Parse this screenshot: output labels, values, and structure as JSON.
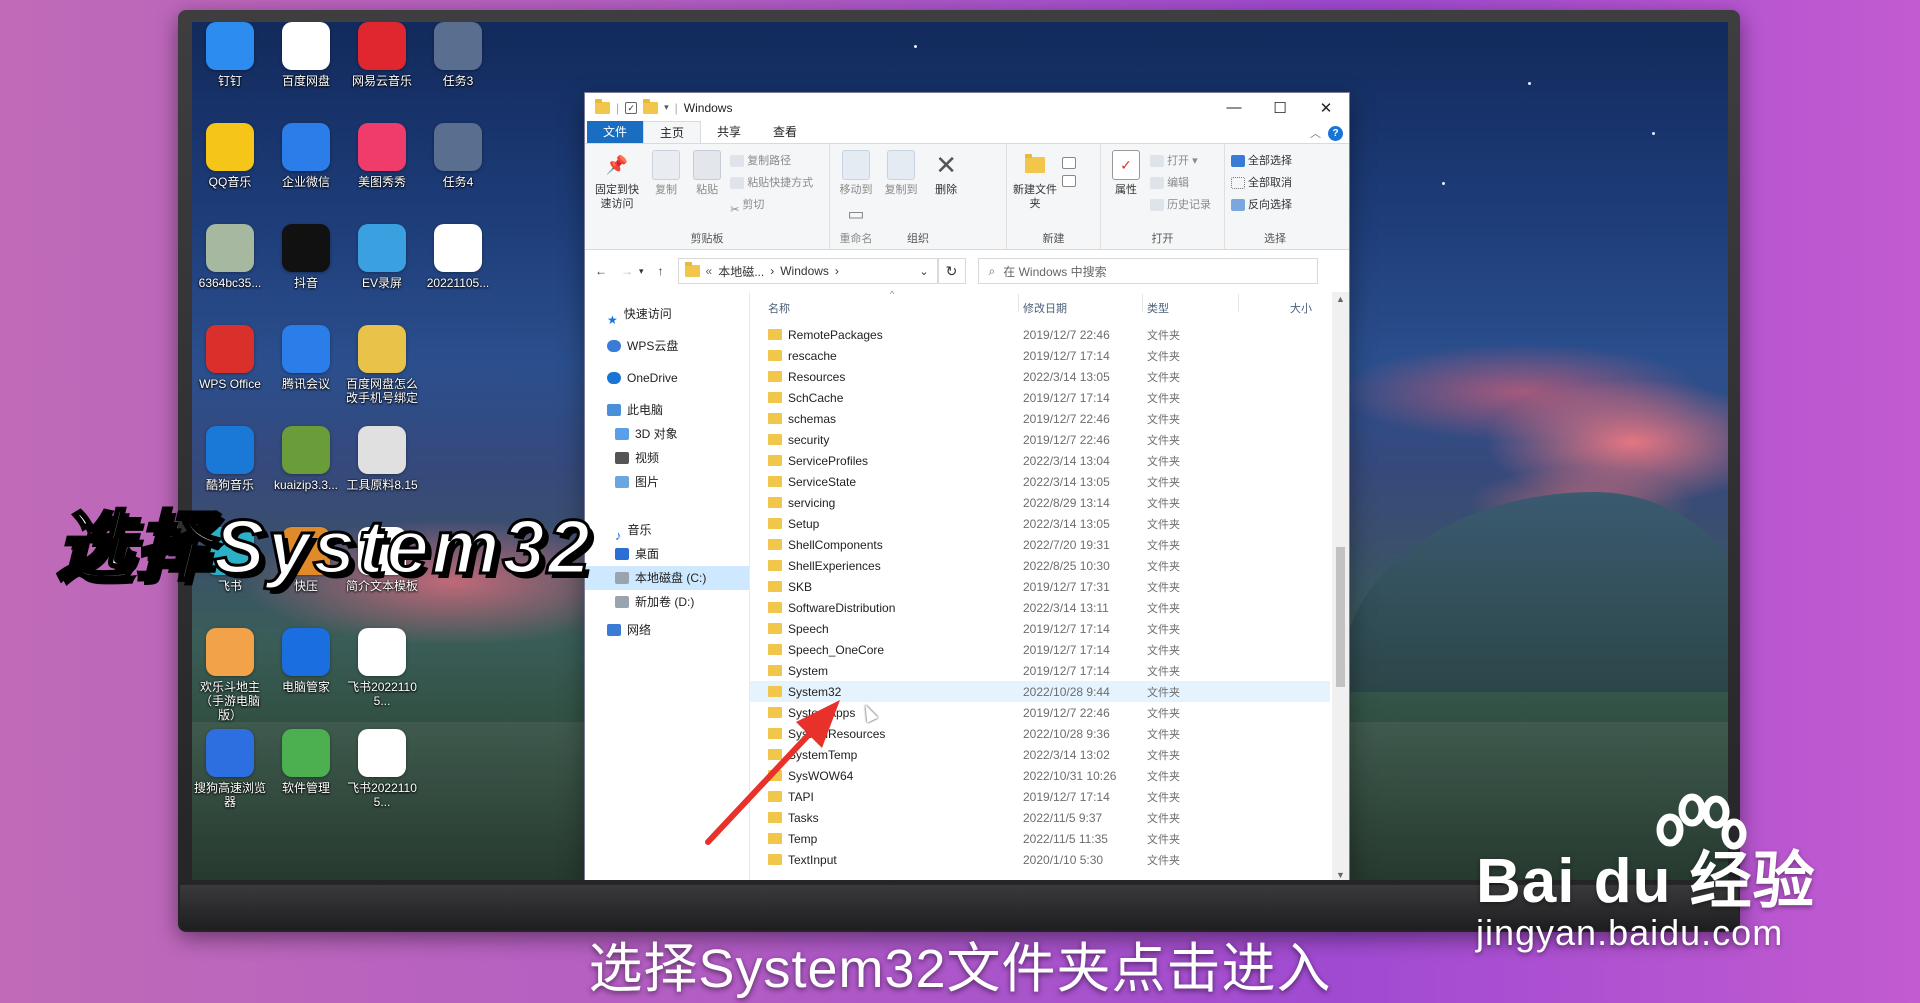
{
  "window": {
    "title": "Windows",
    "min": "—",
    "max": "☐",
    "close": "✕"
  },
  "ribbon_tabs": [
    "文件",
    "主页",
    "共享",
    "查看"
  ],
  "ribbon": {
    "clipboard": {
      "pin": "固定到快速访问",
      "copy": "复制",
      "paste": "粘贴",
      "copy_path": "复制路径",
      "paste_shortcut": "粘贴快捷方式",
      "cut": "剪切",
      "group": "剪贴板"
    },
    "organize": {
      "move_to": "移动到",
      "copy_to": "复制到",
      "delete": "删除",
      "rename": "重命名",
      "group": "组织"
    },
    "new": {
      "new_folder": "新建文件夹",
      "group": "新建"
    },
    "open": {
      "properties": "属性",
      "open": "打开",
      "edit": "编辑",
      "history": "历史记录",
      "group": "打开"
    },
    "select": {
      "select_all": "全部选择",
      "select_none": "全部取消",
      "invert": "反向选择",
      "group": "选择"
    }
  },
  "address": {
    "crumbs": [
      "本地磁...",
      "Windows"
    ],
    "search_placeholder": "在 Windows 中搜索"
  },
  "nav": [
    "快速访问",
    "WPS云盘",
    "OneDrive",
    "此电脑",
    "3D 对象",
    "视频",
    "图片",
    "音乐",
    "桌面",
    "本地磁盘 (C:)",
    "新加卷 (D:)",
    "网络"
  ],
  "columns": {
    "name": "名称",
    "date": "修改日期",
    "type": "类型",
    "size": "大小"
  },
  "files": [
    {
      "name": "RemotePackages",
      "date": "2019/12/7 22:46",
      "type": "文件夹"
    },
    {
      "name": "rescache",
      "date": "2019/12/7 17:14",
      "type": "文件夹"
    },
    {
      "name": "Resources",
      "date": "2022/3/14 13:05",
      "type": "文件夹"
    },
    {
      "name": "SchCache",
      "date": "2019/12/7 17:14",
      "type": "文件夹"
    },
    {
      "name": "schemas",
      "date": "2019/12/7 22:46",
      "type": "文件夹"
    },
    {
      "name": "security",
      "date": "2019/12/7 22:46",
      "type": "文件夹"
    },
    {
      "name": "ServiceProfiles",
      "date": "2022/3/14 13:04",
      "type": "文件夹"
    },
    {
      "name": "ServiceState",
      "date": "2022/3/14 13:05",
      "type": "文件夹"
    },
    {
      "name": "servicing",
      "date": "2022/8/29 13:14",
      "type": "文件夹"
    },
    {
      "name": "Setup",
      "date": "2022/3/14 13:05",
      "type": "文件夹"
    },
    {
      "name": "ShellComponents",
      "date": "2022/7/20 19:31",
      "type": "文件夹"
    },
    {
      "name": "ShellExperiences",
      "date": "2022/8/25 10:30",
      "type": "文件夹"
    },
    {
      "name": "SKB",
      "date": "2019/12/7 17:31",
      "type": "文件夹"
    },
    {
      "name": "SoftwareDistribution",
      "date": "2022/3/14 13:11",
      "type": "文件夹"
    },
    {
      "name": "Speech",
      "date": "2019/12/7 17:14",
      "type": "文件夹"
    },
    {
      "name": "Speech_OneCore",
      "date": "2019/12/7 17:14",
      "type": "文件夹"
    },
    {
      "name": "System",
      "date": "2019/12/7 17:14",
      "type": "文件夹"
    },
    {
      "name": "System32",
      "date": "2022/10/28 9:44",
      "type": "文件夹"
    },
    {
      "name": "SystemApps",
      "date": "2019/12/7 22:46",
      "type": "文件夹"
    },
    {
      "name": "SystemResources",
      "date": "2022/10/28 9:36",
      "type": "文件夹"
    },
    {
      "name": "SystemTemp",
      "date": "2022/3/14 13:02",
      "type": "文件夹"
    },
    {
      "name": "SysWOW64",
      "date": "2022/10/31 10:26",
      "type": "文件夹"
    },
    {
      "name": "TAPI",
      "date": "2019/12/7 17:14",
      "type": "文件夹"
    },
    {
      "name": "Tasks",
      "date": "2022/11/5 9:37",
      "type": "文件夹"
    },
    {
      "name": "Temp",
      "date": "2022/11/5 11:35",
      "type": "文件夹"
    },
    {
      "name": "TextInput",
      "date": "2020/1/10 5:30",
      "type": "文件夹"
    }
  ],
  "desktop_icons": [
    {
      "label": "钉钉",
      "color": "#2d8cf0"
    },
    {
      "label": "百度网盘",
      "color": "#ffffff"
    },
    {
      "label": "网易云音乐",
      "color": "#e0262f"
    },
    {
      "label": "任务3",
      "color": "#5a6f8f"
    },
    {
      "label": "QQ音乐",
      "color": "#f5c518"
    },
    {
      "label": "企业微信",
      "color": "#2b7de9"
    },
    {
      "label": "美图秀秀",
      "color": "#f03c6a"
    },
    {
      "label": "任务4",
      "color": "#5a6f8f"
    },
    {
      "label": "6364bc35...",
      "color": "#a7b8a0"
    },
    {
      "label": "抖音",
      "color": "#111111"
    },
    {
      "label": "EV录屏",
      "color": "#3aa0e0"
    },
    {
      "label": "20221105...",
      "color": "#ffffff"
    },
    {
      "label": "WPS Office",
      "color": "#d9302c"
    },
    {
      "label": "腾讯会议",
      "color": "#2b7de9"
    },
    {
      "label": "百度网盘怎么改手机号绑定",
      "color": "#e9c24a"
    },
    {
      "label": "酷狗音乐",
      "color": "#1a78d6"
    },
    {
      "label": "kuaizip3.3...",
      "color": "#6a9c3a"
    },
    {
      "label": "工具原料8.15",
      "color": "#e0e0e0"
    },
    {
      "label": "飞书",
      "color": "#2bb0c8"
    },
    {
      "label": "快压",
      "color": "#e08a2a"
    },
    {
      "label": "简介文本模板",
      "color": "#ffffff"
    },
    {
      "label": "欢乐斗地主（手游电脑版）",
      "color": "#f2a34a"
    },
    {
      "label": "电脑管家",
      "color": "#1a6ee0"
    },
    {
      "label": "飞书20221105...",
      "color": "#ffffff"
    },
    {
      "label": "搜狗高速浏览器",
      "color": "#2d6fe0"
    },
    {
      "label": "软件管理",
      "color": "#4cb050"
    },
    {
      "label": "飞书20221105...",
      "color": "#ffffff"
    }
  ],
  "overlay_title": "选择System32",
  "subtitle": "选择System32文件夹点击进入",
  "watermark": {
    "brand": "Bai du 经验",
    "url": "jingyan.baidu.com"
  }
}
